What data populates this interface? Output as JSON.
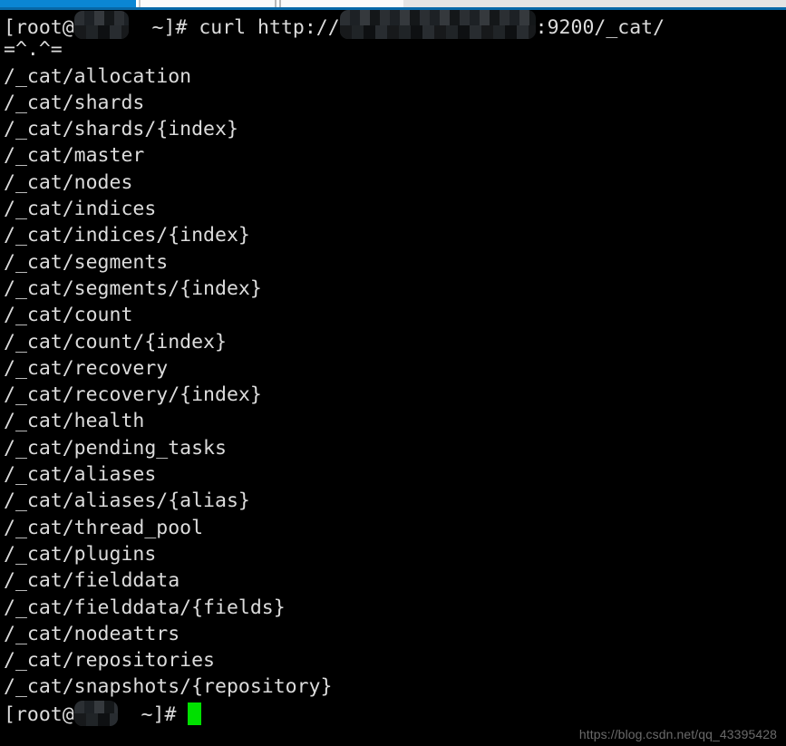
{
  "window": {
    "top_bar": {
      "active_tab_color": "#0b86d4",
      "underline_color": "#0768a8",
      "bar_background": "#f1f1f1"
    }
  },
  "terminal": {
    "background_color": "#000000",
    "text_color": "#dcdcdc",
    "cursor_color": "#00e000",
    "prompt": {
      "user": "root",
      "at": "@",
      "open_bracket": "[",
      "host_redacted": true,
      "path": "~",
      "close": "]#"
    },
    "command_line": {
      "prefix": "[root@",
      "middle": "  ~]# curl http://",
      "suffix": ":9200/_cat/"
    },
    "banner": "=^.^=",
    "endpoints": [
      "/_cat/allocation",
      "/_cat/shards",
      "/_cat/shards/{index}",
      "/_cat/master",
      "/_cat/nodes",
      "/_cat/indices",
      "/_cat/indices/{index}",
      "/_cat/segments",
      "/_cat/segments/{index}",
      "/_cat/count",
      "/_cat/count/{index}",
      "/_cat/recovery",
      "/_cat/recovery/{index}",
      "/_cat/health",
      "/_cat/pending_tasks",
      "/_cat/aliases",
      "/_cat/aliases/{alias}",
      "/_cat/thread_pool",
      "/_cat/plugins",
      "/_cat/fielddata",
      "/_cat/fielddata/{fields}",
      "/_cat/nodeattrs",
      "/_cat/repositories",
      "/_cat/snapshots/{repository}"
    ],
    "final_prompt": {
      "prefix": "[root@",
      "suffix": "  ~]# "
    }
  },
  "watermark": {
    "text": "https://blog.csdn.net/qq_43395428"
  }
}
